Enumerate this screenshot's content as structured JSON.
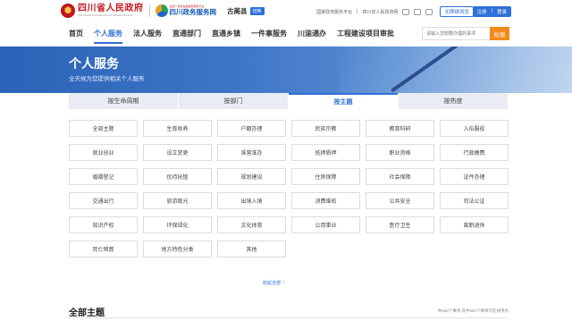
{
  "header": {
    "gov_logo_cn": "四川省人民政府",
    "gov_logo_en": "The People's Government of Sichuan Province",
    "service_logo_small": "全国一体化在线政务服务平台",
    "service_logo_cn": "四川政务服务网",
    "region": "古蔺县",
    "region_switch": "切换",
    "national_platform": "国家政务服务平台",
    "gov_site": "四川省人民政府网",
    "accessibility": "无障碍浏览",
    "register": "注册",
    "login": "登录"
  },
  "nav": {
    "items": [
      "首页",
      "个人服务",
      "法人服务",
      "直通部门",
      "直通乡镇",
      "一件事服务",
      "川渝通办",
      "工程建设项目审批"
    ],
    "active_index": 1,
    "search_placeholder": "请输入您想要办理的事项",
    "search_button": "检索"
  },
  "banner": {
    "title": "个人服务",
    "subtitle": "全天候为您提供相关个人服务"
  },
  "tabs": [
    "按生命周期",
    "按部门",
    "按主题",
    "按热度"
  ],
  "active_tab_index": 2,
  "subjects": [
    "全部主题",
    "生育收养",
    "户籍办理",
    "民族宗教",
    "教育科研",
    "入伍服役",
    "就业创业",
    "设立变更",
    "准营准办",
    "抵押质押",
    "职业资格",
    "行政缴费",
    "婚姻登记",
    "优待抚恤",
    "规划建设",
    "住房保障",
    "社会保障",
    "证件办理",
    "交通出行",
    "旅游观光",
    "出境入境",
    "消费维权",
    "公共安全",
    "司法公证",
    "知识产权",
    "环保绿化",
    "文化体育",
    "公用事业",
    "医疗卫生",
    "离职退休",
    "死亡殡葬",
    "地方特色分类",
    "其他"
  ],
  "collapse_label": "收起全部",
  "section": {
    "title": "全部主题",
    "count_text": "共683个事项,其中682个事项可在线申办"
  },
  "colors": {
    "accent": "#2f6fd8",
    "search_button": "#f28a1a",
    "gov_red": "#c8161d"
  }
}
